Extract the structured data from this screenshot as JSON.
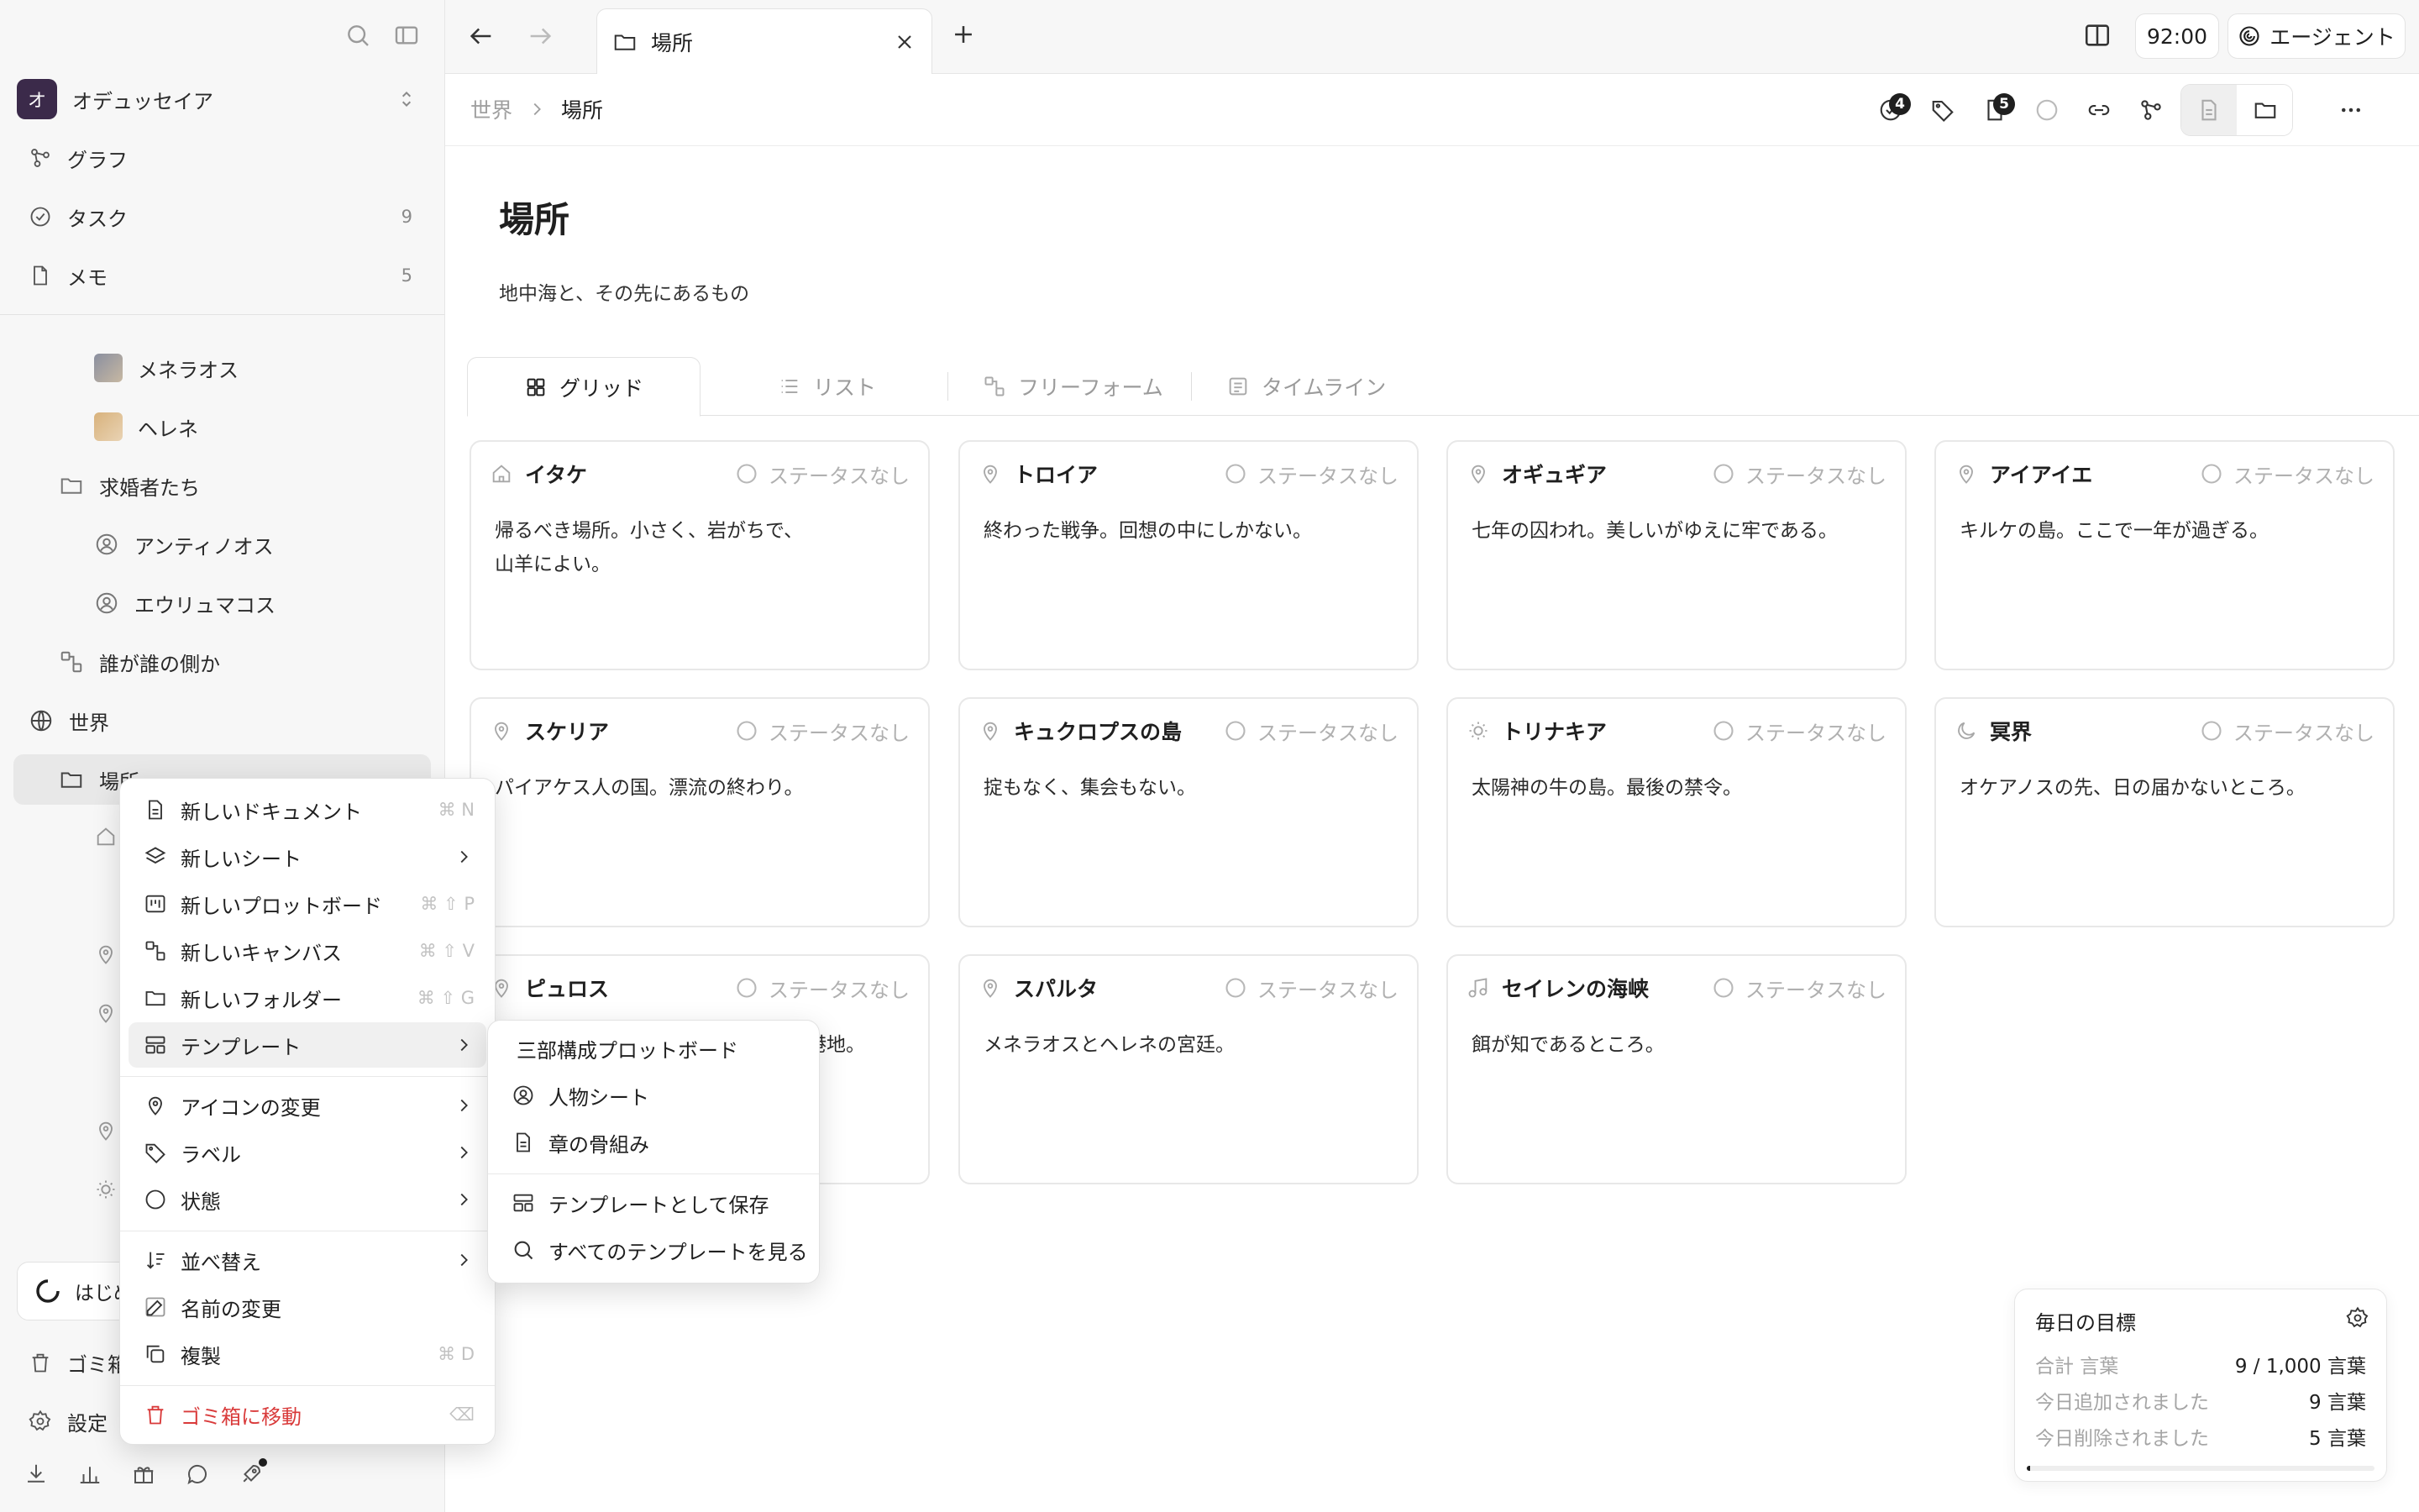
{
  "sidebar": {
    "workspace": {
      "initial": "オ",
      "name": "オデュッセイア"
    },
    "nav": [
      {
        "label": "グラフ",
        "count": ""
      },
      {
        "label": "タスク",
        "count": "9"
      },
      {
        "label": "メモ",
        "count": "5"
      }
    ],
    "tree": {
      "menelaus": "メネラオス",
      "helen": "ヘレネ",
      "suitors_folder": "求婚者たち",
      "antinous": "アンティノオス",
      "eurymachus": "エウリュマコス",
      "who_side": "誰が誰の側か",
      "world": "世界",
      "places": "場所"
    },
    "bottom": {
      "getting_started": "はじめ",
      "trash": "ゴミ箱",
      "settings": "設定"
    }
  },
  "topbar": {
    "tab_title": "場所",
    "time": "92:00",
    "agent_label": "エージェント"
  },
  "breadcrumb": {
    "parent": "世界",
    "current": "場所"
  },
  "toolbar": {
    "tasks_badge": "4",
    "docs_badge": "5"
  },
  "page": {
    "title": "場所",
    "description": "地中海と、その先にあるもの"
  },
  "view_tabs": [
    "グリッド",
    "リスト",
    "フリーフォーム",
    "タイムライン"
  ],
  "status_label": "ステータスなし",
  "cards": [
    {
      "title": "イタケ",
      "icon": "home-icon",
      "body": "帰るべき場所。小さく、岩がちで、\n山羊によい。"
    },
    {
      "title": "トロイア",
      "icon": "map-pin-icon",
      "body": "終わった戦争。回想の中にしかない。"
    },
    {
      "title": "オギュギア",
      "icon": "map-pin-icon",
      "body": "七年の囚われ。美しいがゆえに牢である。"
    },
    {
      "title": "アイアイエ",
      "icon": "map-pin-icon",
      "body": "キルケの島。ここで一年が過ぎる。"
    },
    {
      "title": "スケリア",
      "icon": "map-pin-icon",
      "body": "パイアケス人の国。漂流の終わり。"
    },
    {
      "title": "キュクロプスの島",
      "icon": "map-pin-icon",
      "body": "掟もなく、集会もない。"
    },
    {
      "title": "トリナキア",
      "icon": "sun-icon",
      "body": "太陽神の牛の島。最後の禁令。"
    },
    {
      "title": "冥界",
      "icon": "moon-icon",
      "body": "オケアノスの先、日の届かないところ。"
    },
    {
      "title": "ピュロス",
      "icon": "map-pin-icon",
      "body": "港地。"
    },
    {
      "title": "スパルタ",
      "icon": "map-pin-icon",
      "body": "メネラオスとヘレネの宮廷。"
    },
    {
      "title": "セイレンの海峡",
      "icon": "music-icon",
      "body": "餌が知であるところ。"
    }
  ],
  "daily_goal": {
    "title": "毎日の目標",
    "rows": [
      {
        "label": "合計 言葉",
        "value": "9 / 1,000 言葉"
      },
      {
        "label": "今日追加されました",
        "value": "9 言葉"
      },
      {
        "label": "今日削除されました",
        "value": "5 言葉"
      }
    ],
    "progress": 0.009
  },
  "context_menu": {
    "items": [
      {
        "label": "新しいドキュメント",
        "shortcut": "⌘ N"
      },
      {
        "label": "新しいシート",
        "shortcut": ""
      },
      {
        "label": "新しいプロットボード",
        "shortcut": "⌘ ⇧ P"
      },
      {
        "label": "新しいキャンバス",
        "shortcut": "⌘ ⇧ V"
      },
      {
        "label": "新しいフォルダー",
        "shortcut": "⌘ ⇧ G"
      },
      {
        "label": "テンプレート",
        "shortcut": ""
      },
      {
        "label": "アイコンの変更",
        "shortcut": ""
      },
      {
        "label": "ラベル",
        "shortcut": ""
      },
      {
        "label": "状態",
        "shortcut": ""
      },
      {
        "label": "並べ替え",
        "shortcut": ""
      },
      {
        "label": "名前の変更",
        "shortcut": ""
      },
      {
        "label": "複製",
        "shortcut": "⌘ D"
      },
      {
        "label": "ゴミ箱に移動",
        "shortcut": "⌫"
      }
    ]
  },
  "template_menu": {
    "items": [
      "三部構成プロットボード",
      "人物シート",
      "章の骨組み",
      "テンプレートとして保存",
      "すべてのテンプレートを見る"
    ]
  },
  "colors": {
    "danger": "#d93a3a",
    "workspace_badge": "#3b2a4a"
  }
}
